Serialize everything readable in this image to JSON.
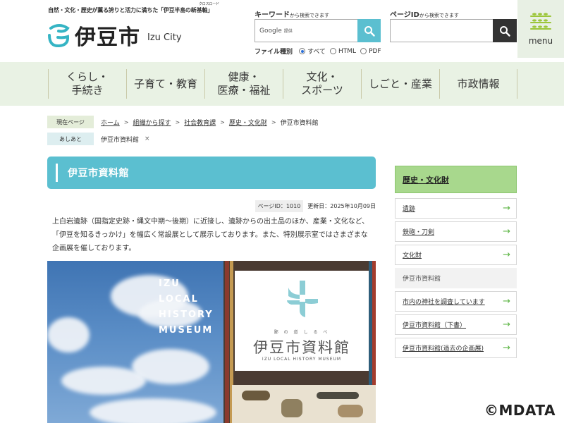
{
  "header": {
    "tagline": "自然・文化・歴史が薫る誇りと活力に満ちた「伊豆半島の新基軸」",
    "tagline_ruby": "クロスロード",
    "logo_jp": "伊豆市",
    "logo_en": "Izu City"
  },
  "search": {
    "keyword_label": "キーワード",
    "keyword_note": "から検索できます",
    "google_label": "Google",
    "google_sub": "提供",
    "filetype_label": "ファイル種別",
    "filetype_options": [
      "すべて",
      "HTML",
      "PDF"
    ],
    "filetype_selected": "すべて",
    "pageid_label": "ページID",
    "pageid_note": "から検索できます"
  },
  "menu": {
    "label": "menu"
  },
  "nav": {
    "items": [
      "くらし・\n手続き",
      "子育て・教育",
      "健康・\n医療・福祉",
      "文化・\nスポーツ",
      "しごと・産業",
      "市政情報"
    ]
  },
  "breadcrumb": {
    "now_label": "現在ページ",
    "items": [
      "ホーム",
      "組織から探す",
      "社会教育課",
      "歴史・文化財"
    ],
    "current": "伊豆市資料館",
    "trail_label": "あしあと",
    "trail_item": "伊豆市資料館",
    "trail_close": "×"
  },
  "main": {
    "title": "伊豆市資料館",
    "page_id": "ページID：1010",
    "updated": "更新日：2025年10月09日",
    "intro": "上白岩遺跡（国指定史跡・縄文中期〜後期）に近接し、遺跡からの出土品のほか、産業・文化など、「伊豆を知るきっかけ」を幅広く常設展として展示しております。また、特別展示室ではさまざまな企画展を催しております。"
  },
  "hero": {
    "en_lines": [
      "IZU",
      "LOCAL",
      "HISTORY",
      "MUSEUM"
    ],
    "card_small": "鄙 の 道 し る べ",
    "card_jp": "伊豆市資料館",
    "card_en": "IZU LOCAL HISTORY MUSEUM"
  },
  "sidebar": {
    "heading": "歴史・文化財",
    "items": [
      {
        "label": "遺跡",
        "current": false
      },
      {
        "label": "鉄砲・刀剣",
        "current": false
      },
      {
        "label": "文化財",
        "current": false
      },
      {
        "label": "伊豆市資料館",
        "current": true
      },
      {
        "label": "市内の神社を調査しています",
        "current": false
      },
      {
        "label": "伊豆市資料館（下書）",
        "current": false
      },
      {
        "label": "伊豆市資料館(過去の企画展)",
        "current": false
      }
    ],
    "arrow": "→"
  },
  "colors": {
    "accent": "#5bbfd0",
    "nav_bg": "#e9f2e4",
    "side_head": "#a8d88d"
  },
  "watermark": "©MDATA"
}
